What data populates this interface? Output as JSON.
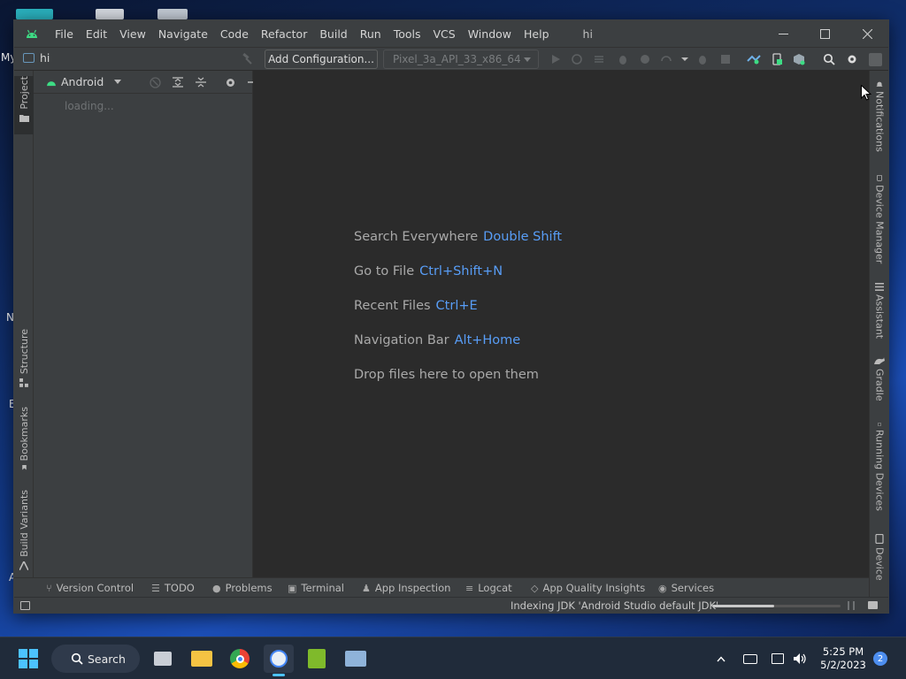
{
  "desktop": {
    "edge_labels": [
      "My",
      "N",
      "E",
      "A"
    ]
  },
  "ide": {
    "menu": [
      "File",
      "Edit",
      "View",
      "Navigate",
      "Code",
      "Refactor",
      "Build",
      "Run",
      "Tools",
      "VCS",
      "Window",
      "Help"
    ],
    "title": "hi",
    "toolbar": {
      "project_name": "hi",
      "add_config_label": "Add Configuration...",
      "device": "Pixel_3a_API_33_x86_64"
    },
    "left_tabs": [
      "Project",
      "Structure",
      "Bookmarks",
      "Build Variants"
    ],
    "project_panel": {
      "view_mode": "Android",
      "loading_text": "loading..."
    },
    "editor_hints": [
      {
        "label": "Search Everywhere",
        "shortcut": "Double Shift"
      },
      {
        "label": "Go to File",
        "shortcut": "Ctrl+Shift+N"
      },
      {
        "label": "Recent Files",
        "shortcut": "Ctrl+E"
      },
      {
        "label": "Navigation Bar",
        "shortcut": "Alt+Home"
      },
      {
        "label": "Drop files here to open them",
        "shortcut": ""
      }
    ],
    "right_tabs": [
      "Notifications",
      "Device Manager",
      "Assistant",
      "Gradle",
      "Running Devices",
      "Device"
    ],
    "bottom_tabs": [
      "Version Control",
      "TODO",
      "Problems",
      "Terminal",
      "App Inspection",
      "Logcat",
      "App Quality Insights",
      "Services"
    ],
    "status": {
      "text": "Indexing JDK 'Android Studio default JDK'",
      "progress": 0.48
    }
  },
  "taskbar": {
    "search_label": "Search",
    "time": "5:25 PM",
    "date": "5/2/2023",
    "notification_count": "2"
  },
  "colors": {
    "accent_shortcut": "#589df6",
    "ide_bg": "#2b2b2b",
    "panel_bg": "#3c3f41",
    "android_green": "#3ddc84"
  }
}
